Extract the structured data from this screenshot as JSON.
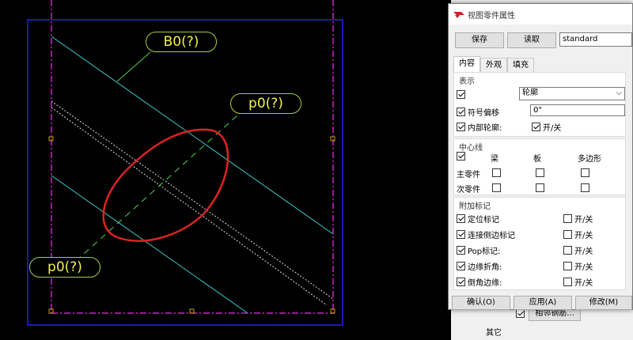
{
  "canvas": {
    "labels": {
      "b0": "B0(?)",
      "p0_top": "p0(?)",
      "p0_bottom": "p0(?)"
    },
    "colors": {
      "frame": "#2222ee",
      "dashed": "#cc22cc",
      "beam_lines": "#3fc7c7",
      "highlight": "#dd2222",
      "node": "#c8a000"
    }
  },
  "dialog": {
    "title": "视图零件属性",
    "save_label": "保存",
    "read_label": "读取",
    "preset_value": "standard",
    "tabs": [
      "内容",
      "外观",
      "填充"
    ],
    "display": {
      "group_title": "表示",
      "mode_value": "轮廓",
      "symbol_offset_label": "符号偏移",
      "symbol_offset_value": "0\"",
      "inner_contour_label": "内部轮廓:",
      "toggle_label": "开/关"
    },
    "centerline": {
      "group_title": "中心线",
      "columns": [
        "梁",
        "板",
        "多边形"
      ],
      "rows": [
        "主零件",
        "次零件"
      ]
    },
    "extra_marks": {
      "group_title": "附加标记",
      "items": [
        {
          "label": "定位标记",
          "toggle": "开/关"
        },
        {
          "label": "连接侧边标记",
          "toggle": "开/关"
        },
        {
          "label": "Pop标记:",
          "toggle": "开/关"
        },
        {
          "label": "边缘折角:",
          "toggle": "开/关"
        },
        {
          "label": "倒角边缘:",
          "toggle": "开/关"
        }
      ]
    },
    "footer": {
      "ok": "确认(O)",
      "apply": "应用(A)",
      "modify": "修改(M)"
    }
  },
  "background_panel": {
    "adjacent_button": "相邻钢筋...",
    "other_label": "其它"
  }
}
